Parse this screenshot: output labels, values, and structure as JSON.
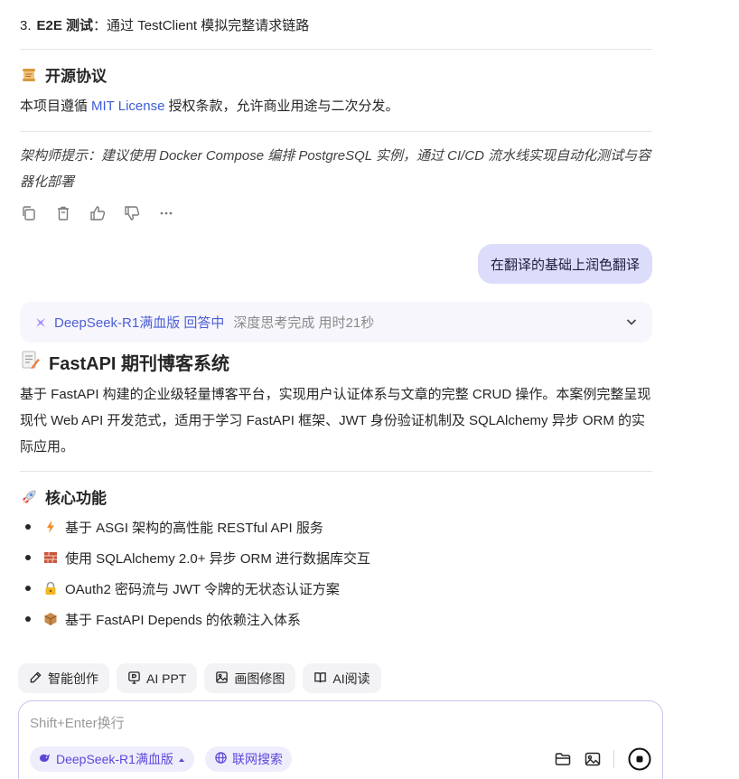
{
  "prev_answer": {
    "list_item": {
      "number": "3.",
      "bold": "E2E 测试",
      "text": "：通过 TestClient 模拟完整请求链路"
    },
    "license": {
      "icon": "scroll-icon",
      "heading": "开源协议",
      "text_before": "本项目遵循",
      "link": "MIT License",
      "text_after": "授权条款，允许商业用途与二次分发。"
    },
    "tip": "架构师提示：建议使用 Docker Compose 编排 PostgreSQL 实例，通过 CI/CD 流水线实现自动化测试与容器化部署",
    "actions": [
      "copy-icon",
      "delete-icon",
      "thumbs-up-icon",
      "thumbs-down-icon",
      "more-icon"
    ]
  },
  "user_message": "在翻译的基础上润色翻译",
  "think_bar": {
    "model": "DeepSeek-R1满血版 回答中",
    "status": "深度思考完成 用时21秒"
  },
  "answer": {
    "title_icon": "memo-icon",
    "title": "FastAPI 期刊博客系统",
    "intro": "基于 FastAPI 构建的企业级轻量博客平台，实现用户认证体系与文章的完整 CRUD 操作。本案例完整呈现现代 Web API 开发范式，适用于学习 FastAPI 框架、JWT 身份验证机制及 SQLAlchemy 异步 ORM 的实际应用。",
    "features_icon": "rocket-icon",
    "features_heading": "核心功能",
    "features": [
      {
        "icon": "lightning-icon",
        "text": "基于 ASGI 架构的高性能 RESTful API 服务"
      },
      {
        "icon": "brick-icon",
        "text": "使用 SQLAlchemy 2.0+ 异步 ORM 进行数据库交互"
      },
      {
        "icon": "lock-key-icon",
        "text": "OAuth2 密码流与 JWT 令牌的无状态认证方案"
      },
      {
        "icon": "package-icon",
        "text": "基于 FastAPI Depends 的依赖注入体系"
      }
    ]
  },
  "toolbar": {
    "items": [
      {
        "icon": "pen-icon",
        "label": "智能创作"
      },
      {
        "icon": "ppt-icon",
        "label": "AI PPT"
      },
      {
        "icon": "image-edit-icon",
        "label": "画图修图"
      },
      {
        "icon": "book-icon",
        "label": "AI阅读"
      }
    ]
  },
  "composer": {
    "placeholder": "Shift+Enter换行",
    "model_chip": "DeepSeek-R1满血版",
    "web_chip": "联网搜索"
  },
  "colors": {
    "accent": "#5b48d9",
    "link": "#3b5cd6",
    "bubble": "#dcdcfb"
  }
}
